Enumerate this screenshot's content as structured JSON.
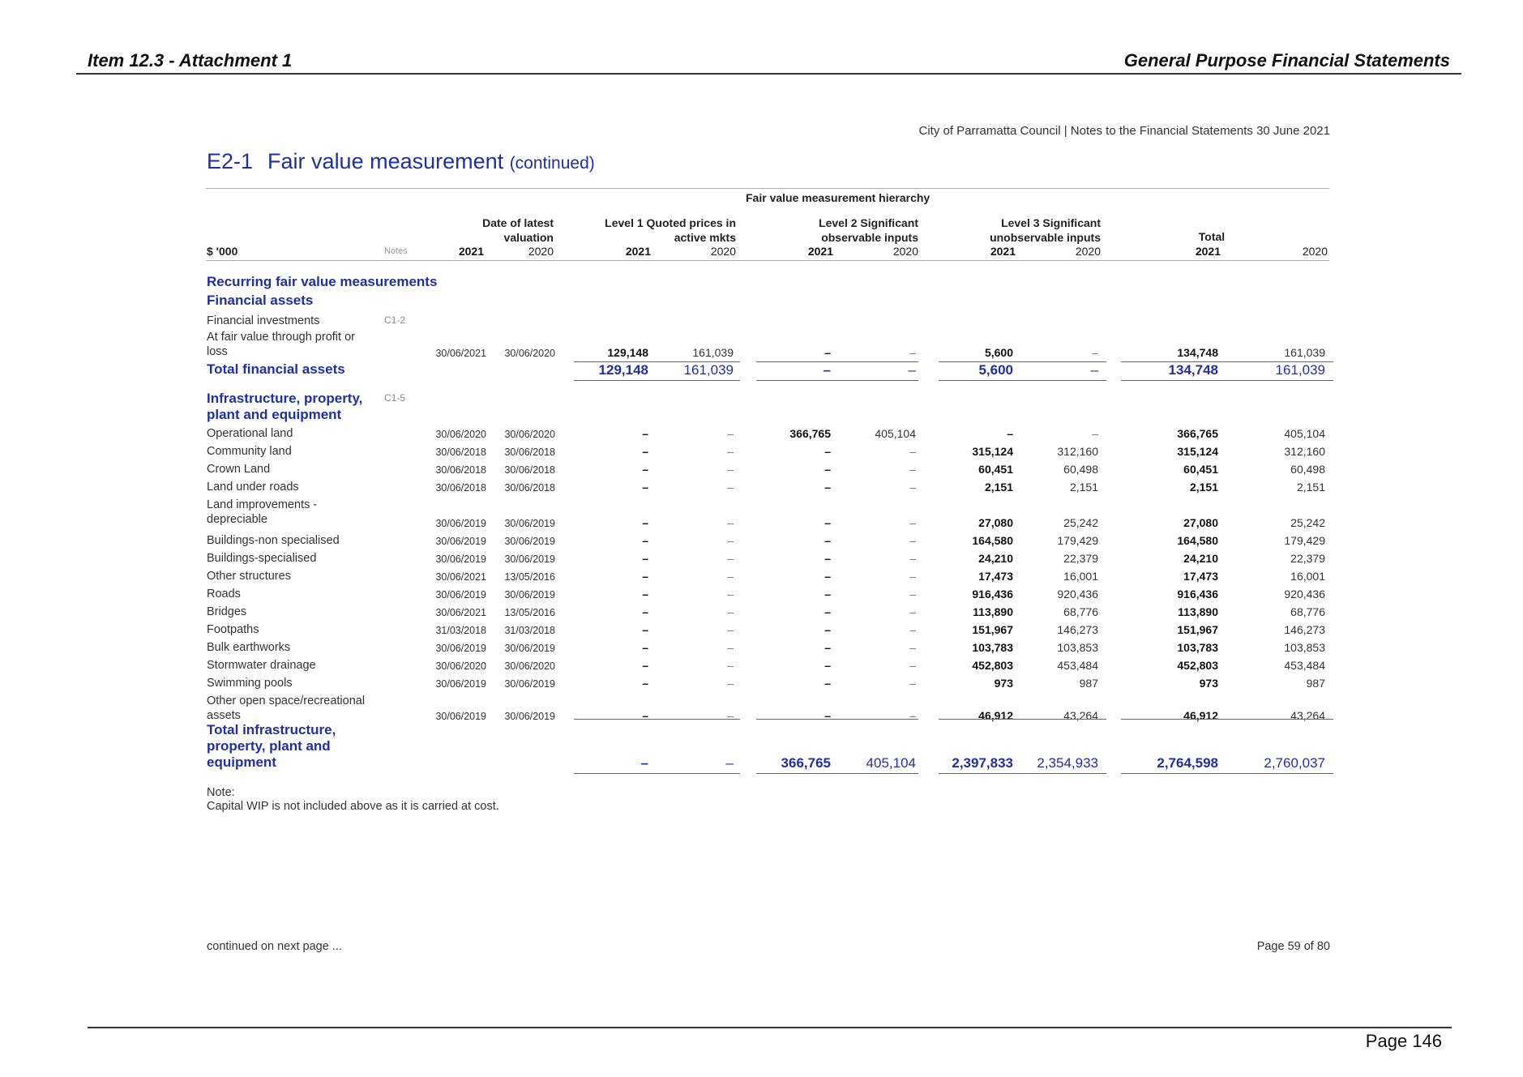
{
  "header": {
    "left": "Item 12.3 - Attachment 1",
    "right": "General Purpose Financial Statements"
  },
  "council_line": "City of Parramatta Council | Notes to the Financial Statements 30 June 2021",
  "section": {
    "code": "E2-1",
    "title": "Fair value measurement",
    "continued": "(continued)"
  },
  "table_header": {
    "hierarchy_label": "Fair value measurement hierarchy",
    "unit": "$ '000",
    "notes": "Notes",
    "date_col": [
      "Date of latest",
      "valuation"
    ],
    "level1": [
      "Level 1 Quoted prices in",
      "active mkts"
    ],
    "level2": [
      "Level 2 Significant",
      "observable inputs"
    ],
    "level3": [
      "Level 3 Significant",
      "unobservable inputs"
    ],
    "total": "Total",
    "y2021": "2021",
    "y2020": "2020"
  },
  "sections": {
    "recurring": "Recurring fair value measurements",
    "financial_assets": "Financial assets",
    "ippe": [
      "Infrastructure, property,",
      "plant and equipment"
    ]
  },
  "financial_rows": [
    {
      "label": "Financial investments",
      "note": "C1-2"
    },
    {
      "label": "At fair value through profit or loss",
      "d1": "30/06/2021",
      "d2": "30/06/2020",
      "l1a": "129,148",
      "l1b": "161,039",
      "l2a": "–",
      "l2b": "–",
      "l3a": "5,600",
      "l3b": "–",
      "ta": "134,748",
      "tb": "161,039"
    }
  ],
  "total_financial": {
    "label": "Total financial assets",
    "l1a": "129,148",
    "l1b": "161,039",
    "l2a": "–",
    "l2b": "–",
    "l3a": "5,600",
    "l3b": "–",
    "ta": "134,748",
    "tb": "161,039"
  },
  "ippe_note": "C1-5",
  "ippe_rows": [
    {
      "label": "Operational land",
      "d1": "30/06/2020",
      "d2": "30/06/2020",
      "l1a": "–",
      "l1b": "–",
      "l2a": "366,765",
      "l2b": "405,104",
      "l3a": "–",
      "l3b": "–",
      "ta": "366,765",
      "tb": "405,104"
    },
    {
      "label": "Community land",
      "d1": "30/06/2018",
      "d2": "30/06/2018",
      "l1a": "–",
      "l1b": "–",
      "l2a": "–",
      "l2b": "–",
      "l3a": "315,124",
      "l3b": "312,160",
      "ta": "315,124",
      "tb": "312,160"
    },
    {
      "label": "Crown Land",
      "d1": "30/06/2018",
      "d2": "30/06/2018",
      "l1a": "–",
      "l1b": "–",
      "l2a": "–",
      "l2b": "–",
      "l3a": "60,451",
      "l3b": "60,498",
      "ta": "60,451",
      "tb": "60,498"
    },
    {
      "label": "Land under roads",
      "d1": "30/06/2018",
      "d2": "30/06/2018",
      "l1a": "–",
      "l1b": "–",
      "l2a": "–",
      "l2b": "–",
      "l3a": "2,151",
      "l3b": "2,151",
      "ta": "2,151",
      "tb": "2,151"
    },
    {
      "label": "Land improvements - depreciable",
      "d1": "30/06/2019",
      "d2": "30/06/2019",
      "l1a": "–",
      "l1b": "–",
      "l2a": "–",
      "l2b": "–",
      "l3a": "27,080",
      "l3b": "25,242",
      "ta": "27,080",
      "tb": "25,242"
    },
    {
      "label": "Buildings-non specialised",
      "d1": "30/06/2019",
      "d2": "30/06/2019",
      "l1a": "–",
      "l1b": "–",
      "l2a": "–",
      "l2b": "–",
      "l3a": "164,580",
      "l3b": "179,429",
      "ta": "164,580",
      "tb": "179,429"
    },
    {
      "label": "Buildings-specialised",
      "d1": "30/06/2019",
      "d2": "30/06/2019",
      "l1a": "–",
      "l1b": "–",
      "l2a": "–",
      "l2b": "–",
      "l3a": "24,210",
      "l3b": "22,379",
      "ta": "24,210",
      "tb": "22,379"
    },
    {
      "label": "Other structures",
      "d1": "30/06/2021",
      "d2": "13/05/2016",
      "l1a": "–",
      "l1b": "–",
      "l2a": "–",
      "l2b": "–",
      "l3a": "17,473",
      "l3b": "16,001",
      "ta": "17,473",
      "tb": "16,001"
    },
    {
      "label": "Roads",
      "d1": "30/06/2019",
      "d2": "30/06/2019",
      "l1a": "–",
      "l1b": "–",
      "l2a": "–",
      "l2b": "–",
      "l3a": "916,436",
      "l3b": "920,436",
      "ta": "916,436",
      "tb": "920,436"
    },
    {
      "label": "Bridges",
      "d1": "30/06/2021",
      "d2": "13/05/2016",
      "l1a": "–",
      "l1b": "–",
      "l2a": "–",
      "l2b": "–",
      "l3a": "113,890",
      "l3b": "68,776",
      "ta": "113,890",
      "tb": "68,776"
    },
    {
      "label": "Footpaths",
      "d1": "31/03/2018",
      "d2": "31/03/2018",
      "l1a": "–",
      "l1b": "–",
      "l2a": "–",
      "l2b": "–",
      "l3a": "151,967",
      "l3b": "146,273",
      "ta": "151,967",
      "tb": "146,273"
    },
    {
      "label": "Bulk earthworks",
      "d1": "30/06/2019",
      "d2": "30/06/2019",
      "l1a": "–",
      "l1b": "–",
      "l2a": "–",
      "l2b": "–",
      "l3a": "103,783",
      "l3b": "103,853",
      "ta": "103,783",
      "tb": "103,853"
    },
    {
      "label": "Stormwater drainage",
      "d1": "30/06/2020",
      "d2": "30/06/2020",
      "l1a": "–",
      "l1b": "–",
      "l2a": "–",
      "l2b": "–",
      "l3a": "452,803",
      "l3b": "453,484",
      "ta": "452,803",
      "tb": "453,484"
    },
    {
      "label": "Swimming pools",
      "d1": "30/06/2019",
      "d2": "30/06/2019",
      "l1a": "–",
      "l1b": "–",
      "l2a": "–",
      "l2b": "–",
      "l3a": "973",
      "l3b": "987",
      "ta": "973",
      "tb": "987"
    },
    {
      "label": "Other open space/recreational assets",
      "d1": "30/06/2019",
      "d2": "30/06/2019",
      "l1a": "–",
      "l1b": "–",
      "l2a": "–",
      "l2b": "–",
      "l3a": "46,912",
      "l3b": "43,264",
      "ta": "46,912",
      "tb": "43,264"
    }
  ],
  "total_ippe": {
    "label": "Total infrastructure, property, plant and equipment",
    "l1a": "–",
    "l1b": "–",
    "l2a": "366,765",
    "l2b": "405,104",
    "l3a": "2,397,833",
    "l3b": "2,354,933",
    "ta": "2,764,598",
    "tb": "2,760,037"
  },
  "note": {
    "heading": "Note:",
    "text": "Capital WIP is not included above as it is carried at cost."
  },
  "footer": {
    "continued": "continued on next page ...",
    "page_of": "Page 59 of 80",
    "page_number": "Page 146"
  }
}
